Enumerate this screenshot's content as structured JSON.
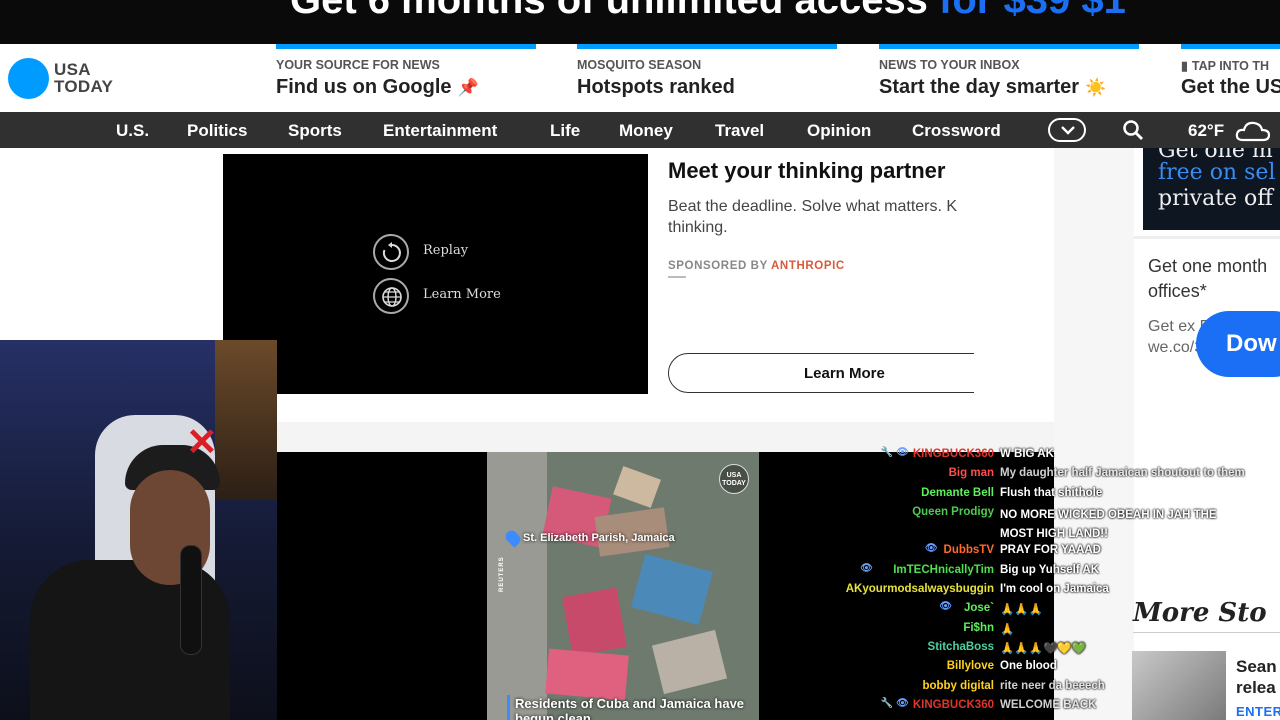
{
  "promo_banner": {
    "text": "Get 6 months of unlimited access ",
    "highlight": "for $39 $1"
  },
  "header": {
    "logo_text": "USA\nTODAY",
    "promos": [
      {
        "eyebrow": "YOUR SOURCE FOR NEWS",
        "headline": "Find us on Google",
        "emoji": "📌"
      },
      {
        "eyebrow": "MOSQUITO SEASON",
        "headline": "Hotspots ranked",
        "emoji": ""
      },
      {
        "eyebrow": "NEWS TO YOUR INBOX",
        "headline": "Start the day smarter",
        "emoji": "☀️"
      },
      {
        "eyebrow": "TAP INTO TH",
        "headline": "Get the US",
        "emoji": ""
      }
    ]
  },
  "nav": {
    "items": [
      "U.S.",
      "Politics",
      "Sports",
      "Entertainment",
      "Life",
      "Money",
      "Travel",
      "Opinion",
      "Crossword"
    ],
    "temperature": "62°F"
  },
  "ad": {
    "replay": "Replay",
    "learn_more_small": "Learn More",
    "title": "Meet your thinking partner",
    "description": "Beat the deadline. Solve what matters. K thinking.",
    "sponsored_prefix": "SPONSORED BY ",
    "sponsor": "ANTHROPIC",
    "cta": "Learn More"
  },
  "sidebar": {
    "ad_lines": [
      "Get one m",
      "free on sel",
      "private off"
    ],
    "ad_headline": "Get one month offices*",
    "ad_sub": "Get ex FREE we.co/3",
    "download": "Dow",
    "more_stories": "More Sto",
    "story_title": "Sean\nrelea",
    "story_tag": "ENTER"
  },
  "stream": {
    "location": "St. Elizabeth Parish, Jamaica",
    "caption": "Residents of Cuba and Jamaica have begun clean",
    "badge": "USA TODAY",
    "source": "REUTERS"
  },
  "chat": [
    {
      "user": "KINGBUCK360",
      "color": "#e0352b",
      "icons": "🔧 👁",
      "msg": "W BIG AK"
    },
    {
      "user": "Big man",
      "color": "#ff4d4d",
      "icons": "",
      "msg": "My daughter half Jamaican shoutout to them"
    },
    {
      "user": "Demante Bell",
      "color": "#5cf05c",
      "icons": "",
      "msg": "Flush that shithole"
    },
    {
      "user": "Queen Prodigy",
      "color": "#4fc94f",
      "icons": "",
      "msg": "NO MORE WICKED OBEAH IN JAH THE MOST HIGH LAND!!"
    },
    {
      "user": "DubbsTV",
      "color": "#ff6a2b",
      "icons": "👁",
      "msg": "PRAY FOR YAAAD"
    },
    {
      "user": "ImTECHnicallyTim",
      "color": "#4fe04f",
      "icons": "👁",
      "msg": "Big up Yuhself AK"
    },
    {
      "user": "AKyourmodsalwaysbuggin",
      "color": "#e8e23a",
      "icons": "",
      "msg": "I'm cool on Jamaica"
    },
    {
      "user": "Jose`",
      "color": "#5cf05c",
      "icons": "👁",
      "msg": "🙏🙏🙏"
    },
    {
      "user": "Fi$hn",
      "color": "#5cf05c",
      "icons": "",
      "msg": "🙏"
    },
    {
      "user": "StitchaBoss",
      "color": "#4fd0a0",
      "icons": "",
      "msg": "🙏🙏🙏🖤💛💚"
    },
    {
      "user": "Billylove",
      "color": "#ffd21f",
      "icons": "",
      "msg": "One blood"
    },
    {
      "user": "bobby digital",
      "color": "#ffd21f",
      "icons": "",
      "msg": "rite neer da beeech"
    },
    {
      "user": "KINGBUCK360",
      "color": "#e0352b",
      "icons": "🔧 👁",
      "msg": "WELCOME BACK"
    }
  ],
  "colors": {
    "usa_today_blue": "#009bff",
    "nav_bg": "#303030",
    "cta_blue": "#1a6ff5",
    "sponsor": "#d95a3a"
  }
}
